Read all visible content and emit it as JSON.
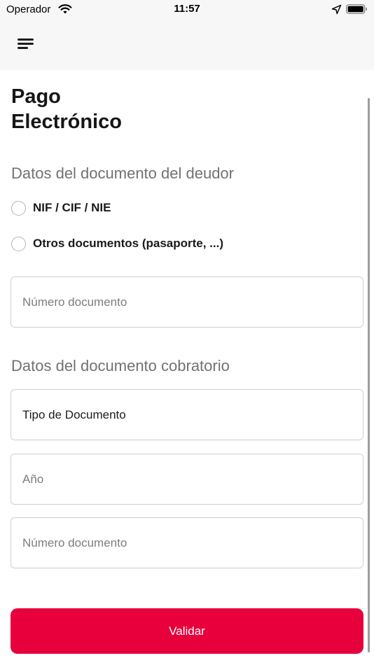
{
  "status_bar": {
    "carrier": "Operador",
    "time": "11:57",
    "wifi_icon": "wifi-icon",
    "location_icon": "location-arrow-icon",
    "battery_icon": "battery-icon"
  },
  "nav": {
    "menu_icon": "hamburger-menu-icon"
  },
  "page": {
    "title_line1": "Pago",
    "title_line2": "Electrónico"
  },
  "debtor_section": {
    "title": "Datos del documento del deudor",
    "options": [
      {
        "label": "NIF / CIF / NIE",
        "selected": false
      },
      {
        "label": "Otros documentos (pasaporte, ...)",
        "selected": false
      }
    ],
    "document_number": {
      "value": "",
      "placeholder": "Número documento"
    }
  },
  "collection_section": {
    "title": "Datos del documento cobratorio",
    "document_type": {
      "value": "Tipo de Documento"
    },
    "year": {
      "value": "",
      "placeholder": "Año"
    },
    "document_number": {
      "value": "",
      "placeholder": "Número documento"
    }
  },
  "actions": {
    "validate_label": "Validar"
  },
  "colors": {
    "accent": "#e8003d",
    "nav_background": "#f7f7f7",
    "section_title": "#727272",
    "field_border": "#cfcfcf"
  }
}
